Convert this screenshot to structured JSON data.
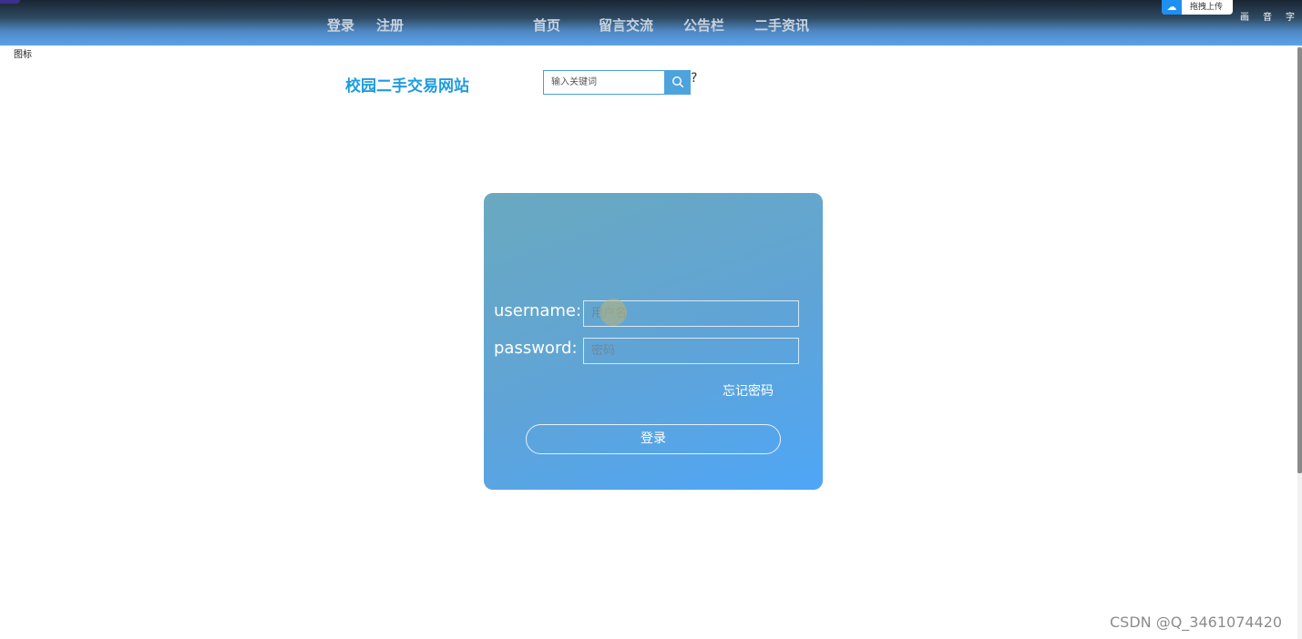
{
  "nav": {
    "left_links": [
      "登录",
      "注册"
    ],
    "main_links": [
      "首页",
      "留言交流",
      "公告栏",
      "二手资讯"
    ]
  },
  "toolbar": {
    "upload_label": "拖拽上传",
    "tools": [
      "画",
      "音",
      "字"
    ]
  },
  "broken_image_text": "图标",
  "site_title": "校园二手交易网站",
  "search": {
    "placeholder": "输入关键词",
    "stray_text": "?"
  },
  "login": {
    "username_label": "username:",
    "username_placeholder": "用户名",
    "password_label": "password:",
    "password_placeholder": "密码",
    "forgot_label": "忘记密码",
    "submit_label": "登录"
  },
  "watermark": "CSDN @Q_3461074420",
  "colors": {
    "accent": "#5aa3ea",
    "title": "#1d9ce0",
    "card_start": "#6aa9bf",
    "card_end": "#4ea6f7"
  }
}
